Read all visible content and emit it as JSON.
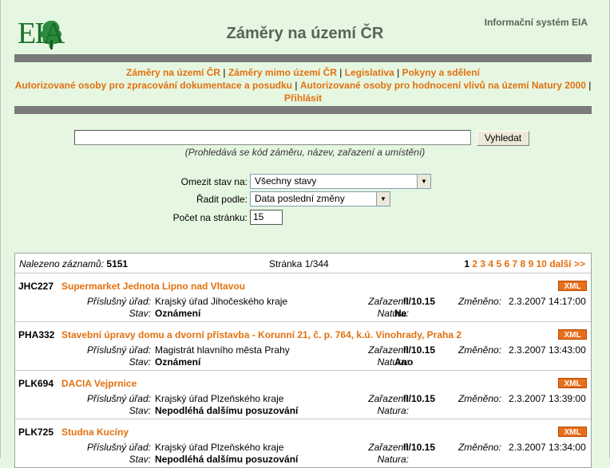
{
  "header": {
    "logo_text": "EIA",
    "site_title": "Záměry na území ČR",
    "system_name": "Informační systém EIA"
  },
  "menu": [
    "Záměry na území ČR",
    "Záměry mimo území ČR",
    "Legislativa",
    "Pokyny a sdělení",
    "Autorizované osoby pro zpracování dokumentace a posudku",
    "Autorizované osoby pro hodnocení vlivů na území Natury 2000",
    "Přihlásit"
  ],
  "search": {
    "value": "",
    "button_label": "Vyhledat",
    "hint": "(Prohledává se kód záměru, název, zařazení a umístění)"
  },
  "filters": {
    "state_label": "Omezit stav na:",
    "state_value": "Všechny stavy",
    "sort_label": "Řadit podle:",
    "sort_value": "Data poslední změny",
    "per_page_label": "Počet na stránku:",
    "per_page_value": "15"
  },
  "results": {
    "found_label": "Nalezeno záznamů:",
    "found_count": "5151",
    "page_info": "Stránka 1/344",
    "pages": [
      "1",
      "2",
      "3",
      "4",
      "5",
      "6",
      "7",
      "8",
      "9",
      "10"
    ],
    "next_label": "další >>",
    "labels": {
      "office": "Příslušný úřad:",
      "state": "Stav:",
      "category": "Zařazení:",
      "natura": "Natura:",
      "changed": "Změněno:"
    },
    "xml_label": "XML",
    "items": [
      {
        "code": "JHC227",
        "title": "Supermarket Jednota Lipno nad Vltavou",
        "office": "Krajský úřad Jihočeského kraje",
        "state": "Oznámení",
        "category": "II/10.15",
        "natura": "Ne",
        "changed": "2.3.2007 14:17:00"
      },
      {
        "code": "PHA332",
        "title": "Stavební úpravy domu a dvorní přístavba - Korunní 21, č. p. 764, k.ú. Vinohrady, Praha 2",
        "office": "Magistrát hlavního města Prahy",
        "state": "Oznámení",
        "category": "II/10.15",
        "natura": "Ano",
        "changed": "2.3.2007 13:43:00"
      },
      {
        "code": "PLK694",
        "title": "DACIA Vejprnice",
        "office": "Krajský úřad Plzeňského kraje",
        "state": "Nepodléhá dalšímu posuzování",
        "category": "II/10.15",
        "natura": "",
        "changed": "2.3.2007 13:39:00"
      },
      {
        "code": "PLK725",
        "title": "Studna Kucíny",
        "office": "Krajský úřad Plzeňského kraje",
        "state": "Nepodléhá dalšímu posuzování",
        "category": "II/10.15",
        "natura": "",
        "changed": "2.3.2007 13:34:00"
      }
    ]
  }
}
